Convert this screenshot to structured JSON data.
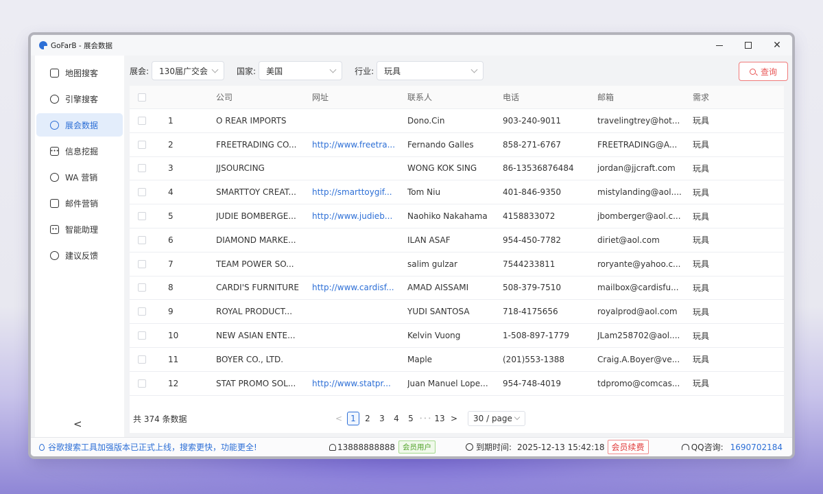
{
  "window": {
    "title": "GoFarB - 展会数据"
  },
  "sidebar": {
    "items": [
      {
        "label": "地图搜客",
        "icon": "map-icon"
      },
      {
        "label": "引擎搜客",
        "icon": "globe-icon"
      },
      {
        "label": "展会数据",
        "icon": "pie-chart-icon",
        "active": true
      },
      {
        "label": "信息挖掘",
        "icon": "chat-dots-icon"
      },
      {
        "label": "WA 营销",
        "icon": "whatsapp-icon"
      },
      {
        "label": "邮件营销",
        "icon": "mail-icon"
      },
      {
        "label": "智能助理",
        "icon": "robot-icon"
      },
      {
        "label": "建议反馈",
        "icon": "feedback-icon"
      }
    ],
    "collapse": "<"
  },
  "filters": {
    "expo_label": "展会:",
    "expo_value": "130届广交会",
    "country_label": "国家:",
    "country_value": "美国",
    "industry_label": "行业:",
    "industry_value": "玩具",
    "query_label": "查询"
  },
  "table": {
    "headers": [
      "公司",
      "网址",
      "联系人",
      "电话",
      "邮箱",
      "需求"
    ],
    "rows": [
      {
        "idx": "1",
        "company": "O REAR IMPORTS",
        "url": "",
        "contact": "Dono.Cin",
        "phone": "903-240-9011",
        "email": "travelingtrey@hot...",
        "need": "玩具"
      },
      {
        "idx": "2",
        "company": "FREETRADING CO...",
        "url": "http://www.freetra...",
        "contact": "Fernando Galles",
        "phone": "858-271-6767",
        "email": "FREETRADING@A...",
        "need": "玩具"
      },
      {
        "idx": "3",
        "company": "JJSOURCING",
        "url": "",
        "contact": "WONG KOK SING",
        "phone": "86-13536876484",
        "email": "jordan@jjcraft.com",
        "need": "玩具"
      },
      {
        "idx": "4",
        "company": "SMARTTOY CREAT...",
        "url": "http://smarttoygif...",
        "contact": "Tom Niu",
        "phone": "401-846-9350",
        "email": "mistylanding@aol....",
        "need": "玩具"
      },
      {
        "idx": "5",
        "company": "JUDIE BOMBERGE...",
        "url": "http://www.judieb...",
        "contact": "Naohiko Nakahama",
        "phone": "4158833072",
        "email": "jbomberger@aol.c...",
        "need": "玩具"
      },
      {
        "idx": "6",
        "company": "DIAMOND MARKE...",
        "url": "",
        "contact": "ILAN ASAF",
        "phone": "954-450-7782",
        "email": "diriet@aol.com",
        "need": "玩具"
      },
      {
        "idx": "7",
        "company": "TEAM POWER SO...",
        "url": "",
        "contact": "salim gulzar",
        "phone": "7544233811",
        "email": "roryante@yahoo.c...",
        "need": "玩具"
      },
      {
        "idx": "8",
        "company": "CARDI'S FURNITURE",
        "url": "http://www.cardisf...",
        "contact": "AMAD AISSAMI",
        "phone": "508-379-7510",
        "email": "mailbox@cardisfu...",
        "need": "玩具"
      },
      {
        "idx": "9",
        "company": "ROYAL PRODUCT...",
        "url": "",
        "contact": "YUDI SANTOSA",
        "phone": "718-4175656",
        "email": "royalprod@aol.com",
        "need": "玩具"
      },
      {
        "idx": "10",
        "company": "NEW ASIAN ENTE...",
        "url": "",
        "contact": "Kelvin Vuong",
        "phone": "1-508-897-1779",
        "email": "JLam258702@aol....",
        "need": "玩具"
      },
      {
        "idx": "11",
        "company": "BOYER CO., LTD.",
        "url": "",
        "contact": "Maple",
        "phone": "(201)553-1388",
        "email": "Craig.A.Boyer@ve...",
        "need": "玩具"
      },
      {
        "idx": "12",
        "company": "STAT PROMO SOL...",
        "url": "http://www.statpr...",
        "contact": "Juan Manuel Lope...",
        "phone": "954-748-4019",
        "email": "tdpromo@comcas...",
        "need": "玩具"
      }
    ]
  },
  "pagination": {
    "total": "共 374 条数据",
    "prev": "<",
    "pages": [
      "1",
      "2",
      "3",
      "4",
      "5"
    ],
    "ellipsis": "• • •",
    "last": "13",
    "next": ">",
    "page_size": "30 / page"
  },
  "status": {
    "notice": "谷歌搜索工具加强版本已正式上线，搜索更快，功能更全!",
    "user_phone": "13888888888",
    "member_tag": "会员用户",
    "expiry_label": "到期时间:",
    "expiry_value": "2025-12-13 15:42:18",
    "renew_label": "会员续费",
    "qq_label": "QQ咨询:",
    "qq_number": "1690702184"
  },
  "colors": {
    "accent": "#2d6fd6",
    "danger": "#e85555",
    "success": "#52a32b"
  }
}
